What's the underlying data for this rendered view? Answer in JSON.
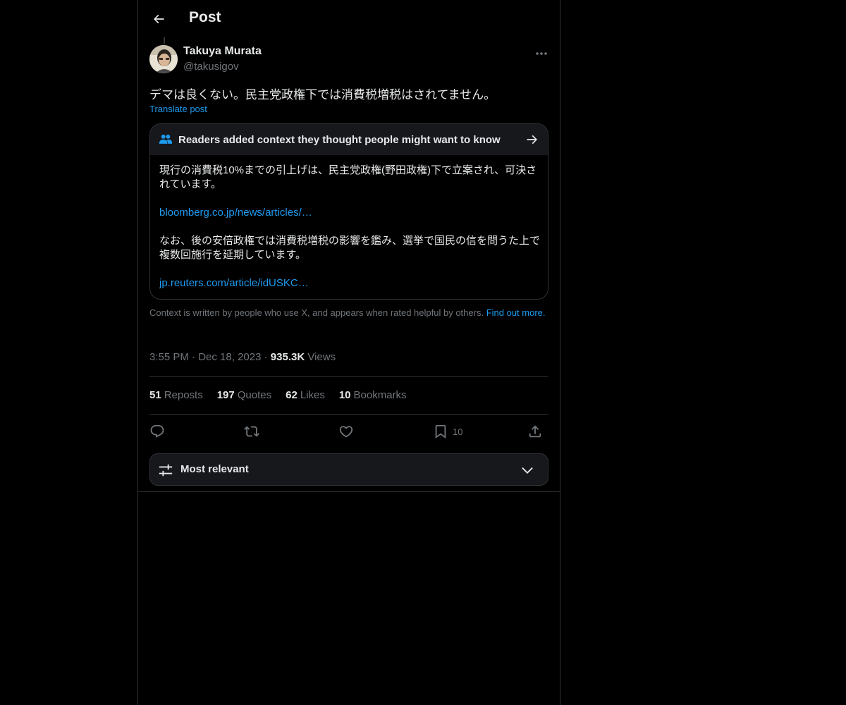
{
  "header": {
    "title": "Post"
  },
  "post": {
    "author_name": "Takuya Murata",
    "author_handle": "@takusigov",
    "text": "デマは良くない。民主党政権下では消費税増税はされてません。",
    "translate_label": "Translate post",
    "time": "3:55 PM",
    "date": "Dec 18, 2023",
    "views_count": "935.3K",
    "views_label": "Views"
  },
  "community_note": {
    "title": "Readers added context they thought people might want to know",
    "paragraph1": "現行の消費税10%までの引上げは、民主党政権(野田政権)下で立案され、可決されています。",
    "link1": "bloomberg.co.jp/news/articles/…",
    "paragraph2": "なお、後の安倍政権では消費税増税の影響を鑑み、選挙で国民の信を問うた上で複数回施行を延期しています。",
    "link2": "jp.reuters.com/article/idUSKC…",
    "footer_text": "Context is written by people who use X, and appears when rated helpful by others.",
    "footer_link": "Find out more."
  },
  "stats": [
    {
      "count": "51",
      "label": "Reposts"
    },
    {
      "count": "197",
      "label": "Quotes"
    },
    {
      "count": "62",
      "label": "Likes"
    },
    {
      "count": "10",
      "label": "Bookmarks"
    }
  ],
  "actions": {
    "bookmark_count": "10"
  },
  "sort": {
    "label": "Most relevant"
  },
  "icons": {
    "back": "arrow-left-icon",
    "more": "more-horizontal-icon",
    "people": "people-icon",
    "arrow": "arrow-right-icon",
    "reply": "reply-icon",
    "repost": "repost-icon",
    "like": "heart-icon",
    "bookmark": "bookmark-icon",
    "share": "share-icon",
    "sort": "sliders-icon",
    "chevron": "chevron-down-icon"
  },
  "colors": {
    "background": "#000000",
    "text_primary": "#e7e9ea",
    "text_secondary": "#71767b",
    "accent": "#1d9bf0",
    "border": "#2f3336",
    "surface": "#16181c"
  }
}
